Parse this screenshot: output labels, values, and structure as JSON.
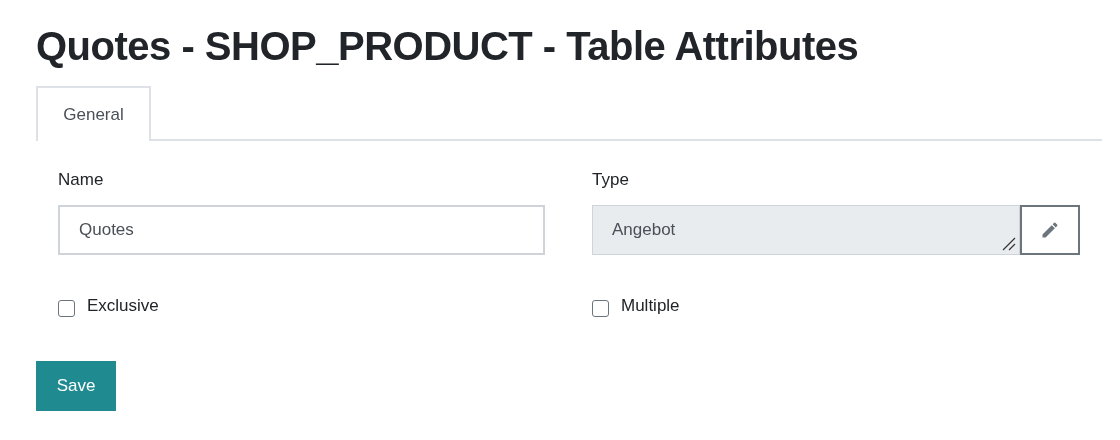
{
  "title": "Quotes - SHOP_PRODUCT - Table Attributes",
  "tabs": [
    {
      "label": "General",
      "selected": true
    }
  ],
  "fields": [
    {
      "label": "Name",
      "value": "Quotes",
      "readonly": false
    },
    {
      "label": "Type",
      "value": "Angebot",
      "readonly": true
    }
  ],
  "checkboxes": [
    {
      "label": "Exclusive",
      "checked": false
    },
    {
      "label": "Multiple",
      "checked": false
    }
  ],
  "save_button": "Save"
}
